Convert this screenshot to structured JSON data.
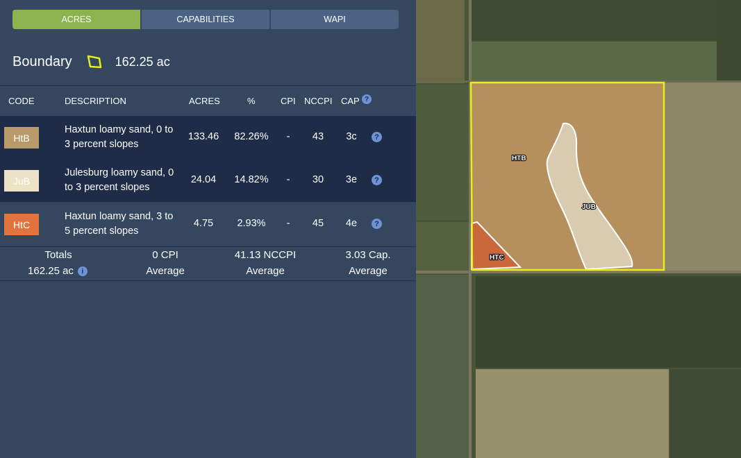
{
  "tabs": [
    {
      "label": "ACRES",
      "active": true
    },
    {
      "label": "CAPABILITIES",
      "active": false
    },
    {
      "label": "WAPI",
      "active": false
    }
  ],
  "boundary": {
    "title": "Boundary",
    "acres": "162.25 ac",
    "icon": "polygon-icon"
  },
  "table": {
    "headers": {
      "code": "CODE",
      "description": "DESCRIPTION",
      "acres": "ACRES",
      "percent": "%",
      "cpi": "CPI",
      "nccpi": "NCCPI",
      "cap": "CAP"
    },
    "rows": [
      {
        "code": "HtB",
        "color": "#b99b6b",
        "description": "Haxtun loamy sand, 0 to 3 percent slopes",
        "acres": "133.46",
        "percent": "82.26%",
        "cpi": "-",
        "nccpi": "43",
        "cap": "3c"
      },
      {
        "code": "JuB",
        "color": "#eee2c6",
        "description": "Julesburg loamy sand, 0 to 3 percent slopes",
        "acres": "24.04",
        "percent": "14.82%",
        "cpi": "-",
        "nccpi": "30",
        "cap": "3e"
      },
      {
        "code": "HtC",
        "color": "#e0743c",
        "description": "Haxtun loamy sand, 3 to 5 percent slopes",
        "acres": "4.75",
        "percent": "2.93%",
        "cpi": "-",
        "nccpi": "45",
        "cap": "4e"
      }
    ]
  },
  "totals": {
    "label": "Totals",
    "acres": "162.25 ac",
    "cpi_value": "0 CPI",
    "cpi_sub": "Average",
    "nccpi_value": "41.13 NCCPI",
    "nccpi_sub": "Average",
    "cap_value": "3.03 Cap.",
    "cap_sub": "Average"
  },
  "map": {
    "labels": {
      "htb": "HTB",
      "jub": "JUB",
      "htc": "HTC"
    },
    "boundary_color": "#e6ee1a"
  }
}
